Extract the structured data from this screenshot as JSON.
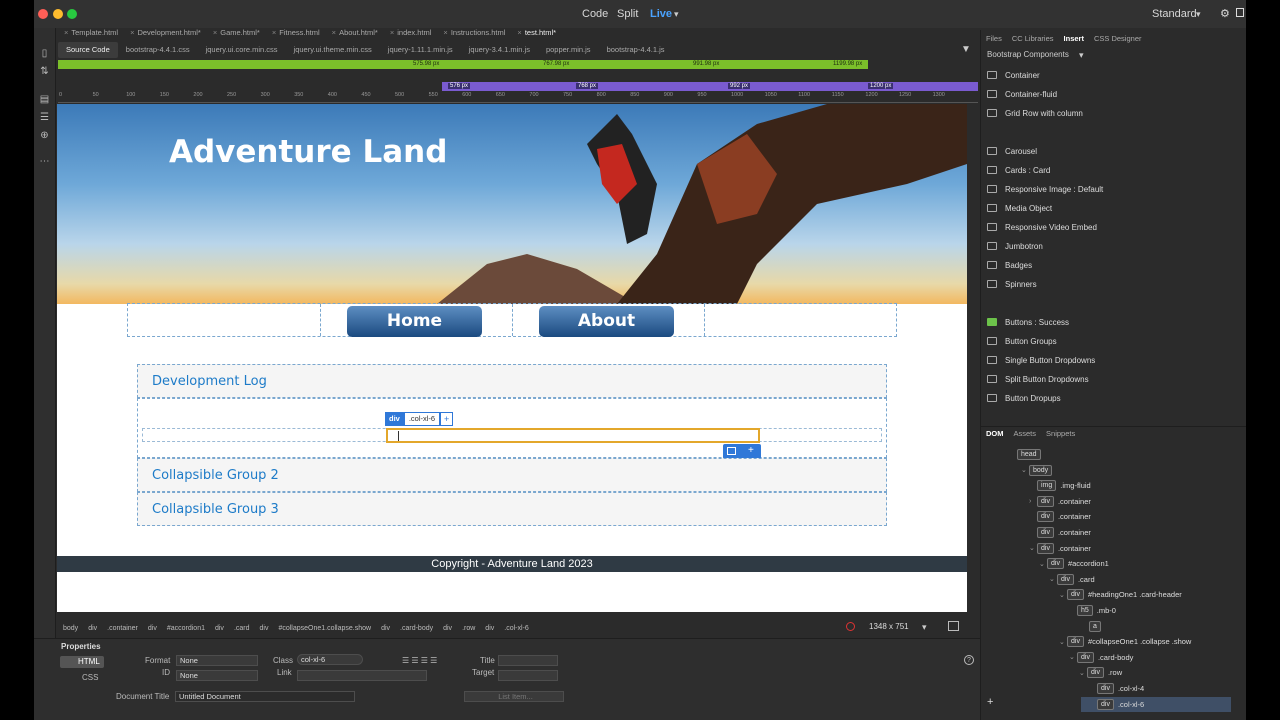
{
  "titlebar": {
    "code": "Code",
    "split": "Split",
    "live": "Live",
    "workspace": "Standard"
  },
  "doc_tabs": [
    "Template.html",
    "Development.html*",
    "Game.html*",
    "Fitness.html",
    "About.html*",
    "index.html",
    "Instructions.html",
    "test.html*"
  ],
  "related_files": [
    "Source Code",
    "bootstrap-4.4.1.css",
    "jquery.ui.core.min.css",
    "jquery.ui.theme.min.css",
    "jquery-1.11.1.min.js",
    "jquery-3.4.1.min.js",
    "popper.min.js",
    "bootstrap-4.4.1.js"
  ],
  "media_queries": {
    "green": [
      "575.98 px",
      "767.98 px",
      "991.98 px",
      "1199.98 px"
    ],
    "purple": [
      "576 px",
      "768 px",
      "992 px",
      "1200 px"
    ]
  },
  "ruler": [
    "0",
    "50",
    "100",
    "150",
    "200",
    "250",
    "300",
    "350",
    "400",
    "450",
    "500",
    "550",
    "600",
    "650",
    "700",
    "750",
    "800",
    "850",
    "900",
    "950",
    "1000",
    "1050",
    "1100",
    "1150",
    "1200",
    "1250",
    "1300"
  ],
  "page": {
    "hero_title": "Adventure Land",
    "nav": [
      "Home",
      "About"
    ],
    "cards": [
      "Development Log",
      "Collapsible Group 2",
      "Collapsible Group 3"
    ],
    "footer": "Copyright - Adventure Land 2023"
  },
  "hud": {
    "tag": "div",
    "cls": ".col-xl-6",
    "plus": "+"
  },
  "right_panel": {
    "tabs": [
      "Files",
      "CC Libraries",
      "Insert",
      "CSS Designer"
    ],
    "category": "Bootstrap Components",
    "insert_items": [
      "Container",
      "Container-fluid",
      "Grid Row with column",
      "Carousel",
      "Cards : Card",
      "Responsive Image : Default",
      "Media Object",
      "Responsive Video Embed",
      "Jumbotron",
      "Badges",
      "Spinners",
      "Buttons : Success",
      "Button Groups",
      "Single Button Dropdowns",
      "Split Button Dropdowns",
      "Button Dropups"
    ],
    "dom_tabs": [
      "DOM",
      "Assets",
      "Snippets"
    ],
    "dom": [
      {
        "tag": "head",
        "cls": ""
      },
      {
        "tag": "body",
        "cls": ""
      },
      {
        "tag": "img",
        "cls": ".img-fluid"
      },
      {
        "tag": "div",
        "cls": ".container"
      },
      {
        "tag": "div",
        "cls": ".container"
      },
      {
        "tag": "div",
        "cls": ".container"
      },
      {
        "tag": "div",
        "cls": ".container"
      },
      {
        "tag": "div",
        "cls": "#accordion1"
      },
      {
        "tag": "div",
        "cls": ".card"
      },
      {
        "tag": "div",
        "cls": "#headingOne1 .card-header"
      },
      {
        "tag": "h5",
        "cls": ".mb-0"
      },
      {
        "tag": "a",
        "cls": ""
      },
      {
        "tag": "div",
        "cls": "#collapseOne1 .collapse .show"
      },
      {
        "tag": "div",
        "cls": ".card-body"
      },
      {
        "tag": "div",
        "cls": ".row"
      },
      {
        "tag": "div",
        "cls": ".col-xl-4"
      },
      {
        "tag": "div",
        "cls": ".col-xl-6"
      }
    ]
  },
  "tag_selector": [
    "body",
    "div",
    ".container",
    "div",
    "#accordion1",
    "div",
    ".card",
    "div",
    "#collapseOne1.collapse.show",
    "div",
    ".card-body",
    "div",
    ".row",
    "div",
    ".col-xl-6"
  ],
  "viewport_size": "1348 x 751",
  "properties": {
    "title": "Properties",
    "html": "HTML",
    "css": "CSS",
    "format_label": "Format",
    "format_value": "None",
    "id_label": "ID",
    "id_value": "None",
    "class_label": "Class",
    "class_value": "col-xl-6",
    "link_label": "Link",
    "title_label": "Title",
    "target_label": "Target",
    "doc_title_label": "Document Title",
    "doc_title_value": "Untitled Document",
    "list_item": "List Item..."
  }
}
